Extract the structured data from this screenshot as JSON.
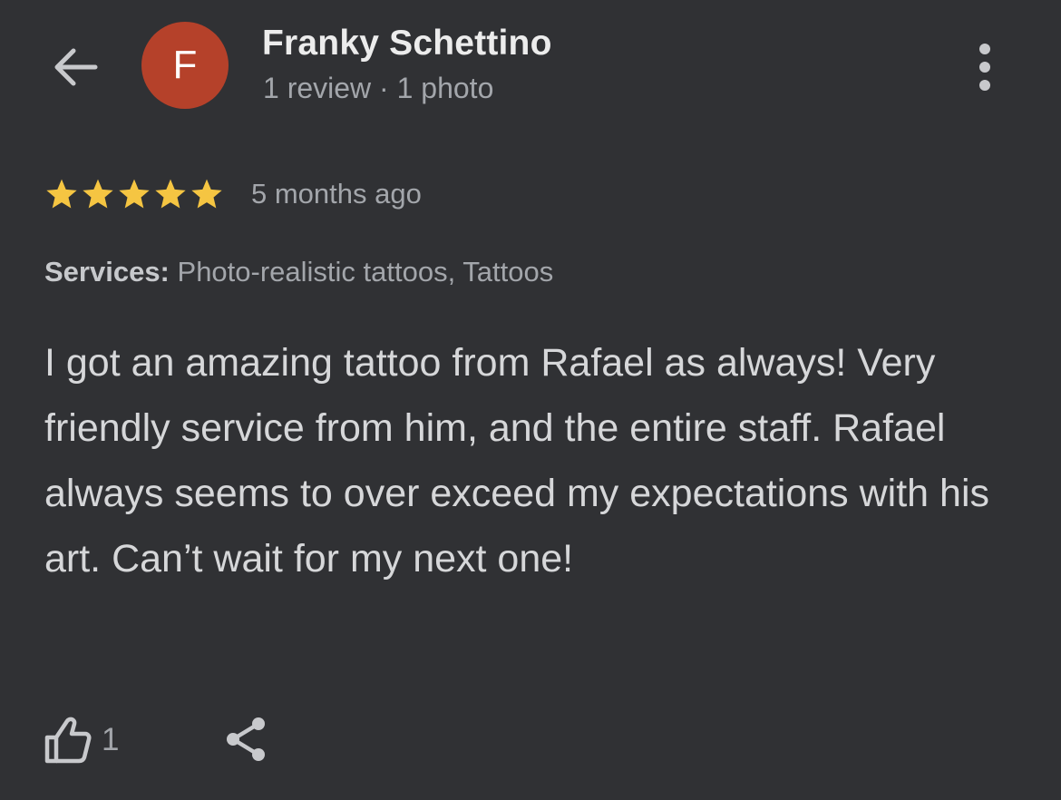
{
  "header": {
    "back_icon": "arrow-back-icon",
    "avatar_letter": "F",
    "avatar_color": "#b5412a",
    "reviewer_name": "Franky Schettino",
    "reviewer_meta": "1 review · 1 photo",
    "more_icon": "more-vertical-icon"
  },
  "review": {
    "rating": 5,
    "rating_max": 5,
    "star_color": "#f5c542",
    "time": "5 months ago",
    "services_label": "Services:",
    "services_value": "Photo-realistic tattoos, Tattoos",
    "text": "I got an amazing tattoo from Rafael as always! Very friendly service from him, and the entire staff. Rafael always seems to over exceed my expectations with his art. Can’t wait for my next one!"
  },
  "actions": {
    "like_icon": "thumbs-up-icon",
    "like_count": "1",
    "share_icon": "share-icon"
  }
}
